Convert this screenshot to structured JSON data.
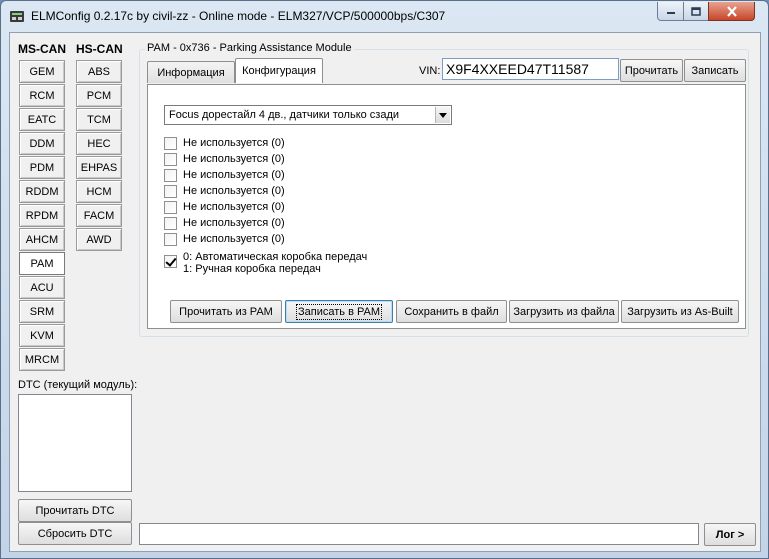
{
  "window": {
    "title": "ELMConfig 0.2.17c by civil-zz - Online mode - ELM327/VCP/500000bps/C307"
  },
  "left_panel": {
    "ms_can_header": "MS-CAN",
    "hs_can_header": "HS-CAN",
    "ms_can_modules": [
      "GEM",
      "RCM",
      "EATC",
      "DDM",
      "PDM",
      "RDDM",
      "RPDM",
      "AHCM",
      "PAM",
      "ACU",
      "SRM",
      "KVM",
      "MRCM"
    ],
    "hs_can_modules": [
      "ABS",
      "PCM",
      "TCM",
      "HEC",
      "EHPAS",
      "HCM",
      "FACM",
      "AWD"
    ],
    "active_module": "PAM",
    "dtc_label": "DTC (текущий модуль):",
    "read_dtc": "Прочитать DTC",
    "reset_dtc": "Сбросить DTC"
  },
  "module_panel": {
    "group_title": "PAM - 0x736 - Parking Assistance Module",
    "tabs": [
      "Информация",
      "Конфигурация"
    ],
    "active_tab": "Конфигурация",
    "vin_label": "VIN:",
    "vin_value": "X9F4XXEED47T11587",
    "read_button": "Прочитать",
    "write_button": "Записать"
  },
  "config": {
    "variant_selected": "Focus дорестайл 4 дв., датчики только сзади",
    "options": [
      {
        "label": "Не используется (0)",
        "checked": false
      },
      {
        "label": "Не используется (0)",
        "checked": false
      },
      {
        "label": "Не используется (0)",
        "checked": false
      },
      {
        "label": "Не используется (0)",
        "checked": false
      },
      {
        "label": "Не используется (0)",
        "checked": false
      },
      {
        "label": "Не используется (0)",
        "checked": false
      },
      {
        "label": "Не используется (0)",
        "checked": false
      }
    ],
    "gearbox_option": {
      "line1": "0: Автоматическая коробка передач",
      "line2": "1: Ручная коробка передач",
      "checked": true
    },
    "actions": [
      "Прочитать из PAM",
      "Записать в PAM",
      "Сохранить в файл",
      "Загрузить из файла",
      "Загрузить из As-Built"
    ],
    "focused_action": "Записать в PAM"
  },
  "log": {
    "button": "Лог >"
  }
}
